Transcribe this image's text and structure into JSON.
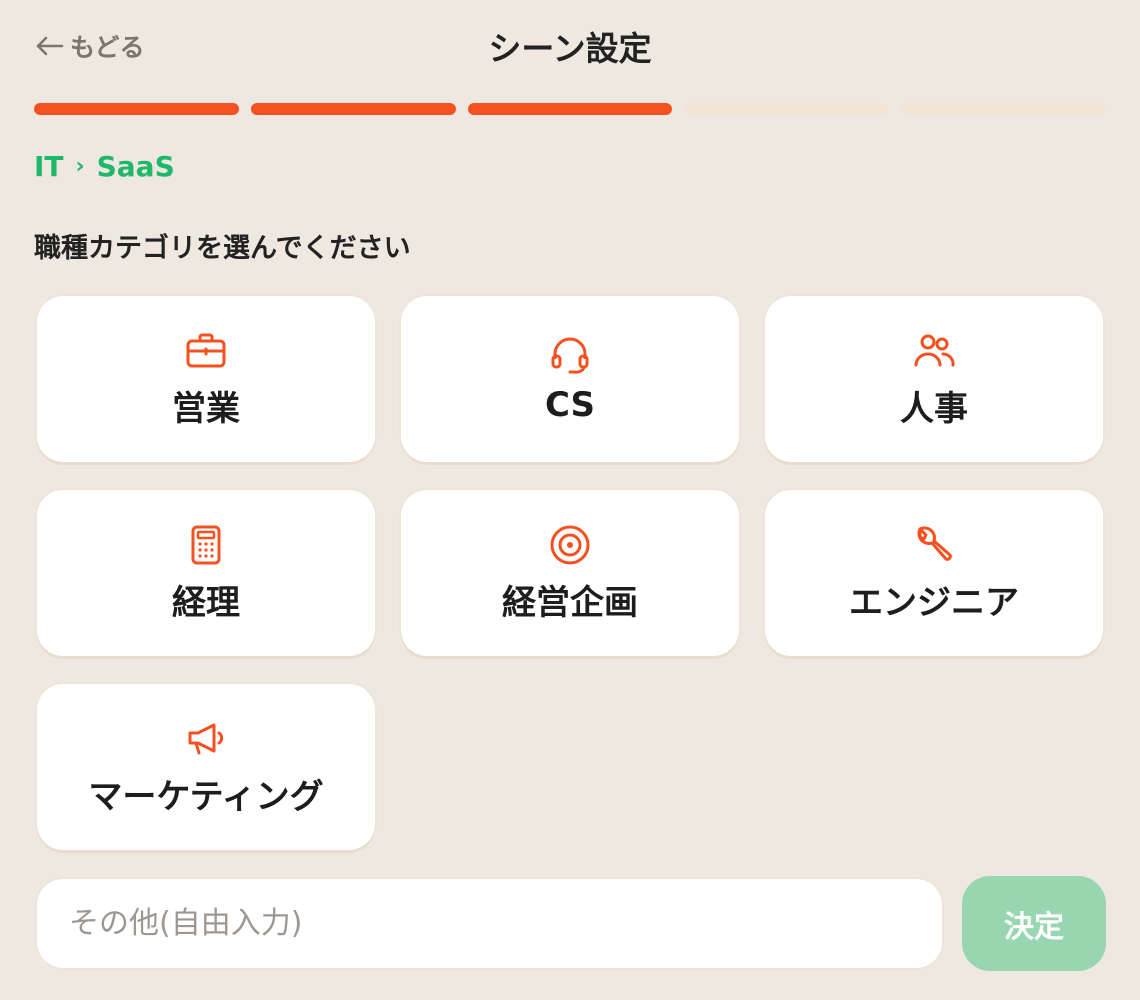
{
  "header": {
    "back_label": "もどる",
    "title": "シーン設定"
  },
  "progress": {
    "steps": 5,
    "current": 3
  },
  "breadcrumb": {
    "parent": "IT",
    "separator": "›",
    "current": "SaaS"
  },
  "prompt": "職種カテゴリを選んでください",
  "categories": [
    {
      "label": "営業",
      "icon": "briefcase-icon"
    },
    {
      "label": "CS",
      "icon": "headset-icon"
    },
    {
      "label": "人事",
      "icon": "users-icon"
    },
    {
      "label": "経理",
      "icon": "calculator-icon"
    },
    {
      "label": "経営企画",
      "icon": "target-icon"
    },
    {
      "label": "エンジニア",
      "icon": "wrench-icon"
    },
    {
      "label": "マーケティング",
      "icon": "megaphone-icon"
    }
  ],
  "other_input": {
    "placeholder": "その他(自由入力)",
    "value": ""
  },
  "submit_label": "決定",
  "colors": {
    "background": "#efe8e0",
    "accent": "#f5501f",
    "progress_inactive": "#f4e4d3",
    "breadcrumb": "#1fb86a",
    "submit_disabled": "#98d6b1"
  }
}
